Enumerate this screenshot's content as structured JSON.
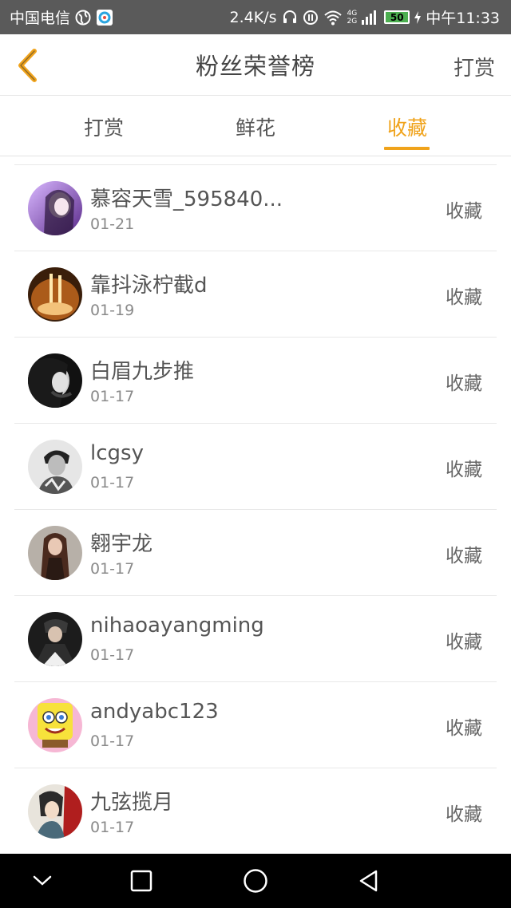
{
  "status_bar": {
    "carrier": "中国电信",
    "speed": "2.4K/s",
    "network_label_top": "4G",
    "network_label_bottom": "2G",
    "battery": "50",
    "time": "中午11:33"
  },
  "header": {
    "title": "粉丝荣誉榜",
    "action": "打赏"
  },
  "tabs": [
    {
      "label": "打赏",
      "active": false
    },
    {
      "label": "鲜花",
      "active": false
    },
    {
      "label": "收藏",
      "active": true
    }
  ],
  "colors": {
    "accent": "#f0a31b",
    "status_bar": "#5a5a5a",
    "nav_bar": "#000000"
  },
  "fans": [
    {
      "name": "慕容天雪_595840...",
      "date": "01-21",
      "action": "收藏"
    },
    {
      "name": "靠抖泳柠截d",
      "date": "01-19",
      "action": "收藏"
    },
    {
      "name": "白眉九步推",
      "date": "01-17",
      "action": "收藏"
    },
    {
      "name": "lcgsy",
      "date": "01-17",
      "action": "收藏"
    },
    {
      "name": "翱宇龙",
      "date": "01-17",
      "action": "收藏"
    },
    {
      "name": "nihaoayangming",
      "date": "01-17",
      "action": "收藏"
    },
    {
      "name": "andyabc123",
      "date": "01-17",
      "action": "收藏"
    },
    {
      "name": "九弦揽月",
      "date": "01-17",
      "action": "收藏"
    }
  ],
  "nav_icons": [
    "chevron-down-icon",
    "recents-square-icon",
    "home-circle-icon",
    "back-triangle-icon"
  ]
}
